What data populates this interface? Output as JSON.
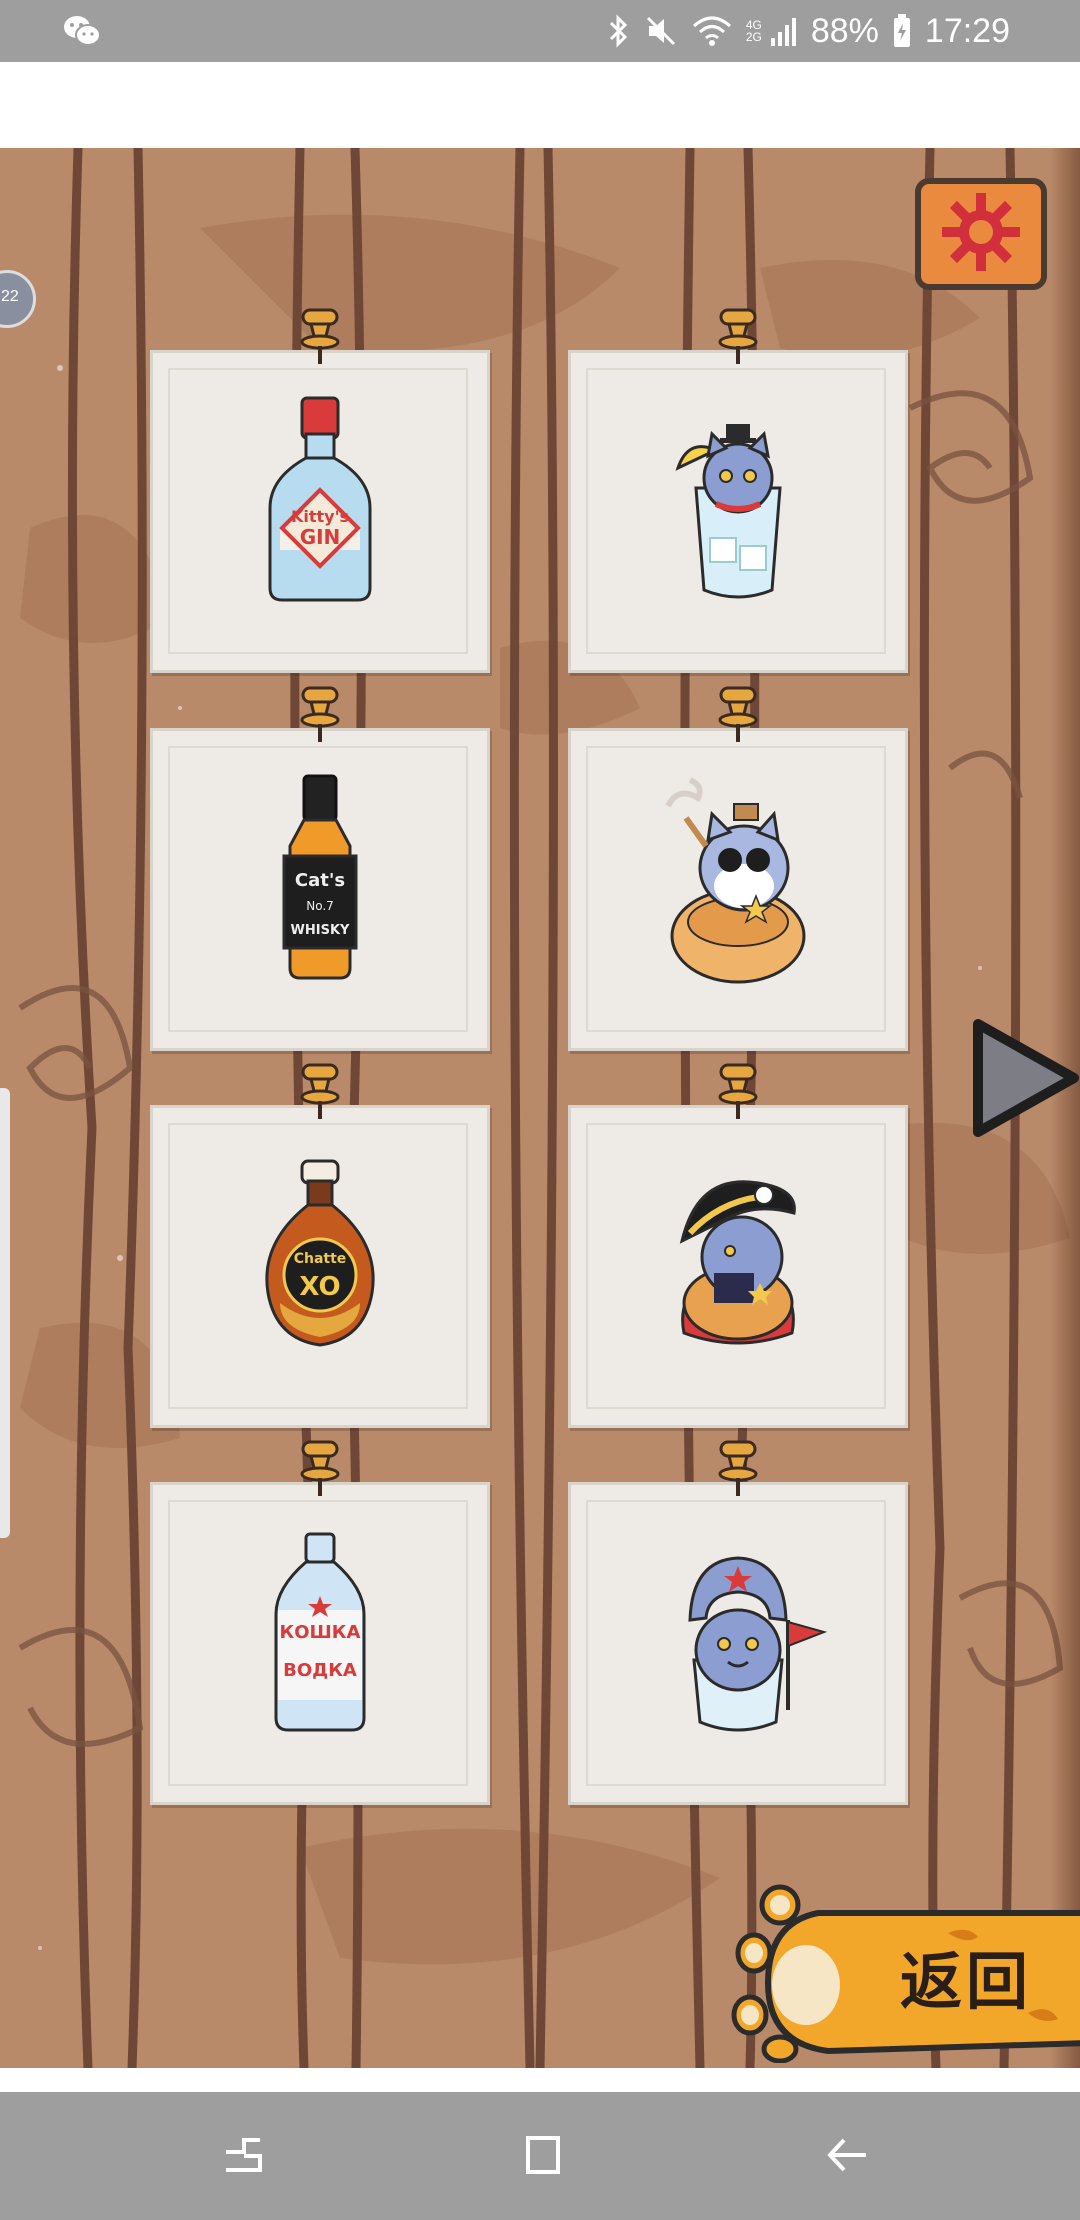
{
  "status_bar": {
    "network": "4G 2G",
    "battery": "88%",
    "time": "17:29",
    "icons": [
      "wechat-icon",
      "bluetooth-icon",
      "mute-icon",
      "wifi-icon",
      "signal-icon",
      "battery-icon"
    ]
  },
  "game": {
    "settings_icon": "gear-icon",
    "next_icon": "play-arrow-icon",
    "side_badge": "22",
    "cards": [
      {
        "name": "gin-bottle",
        "text_lines": [
          "Kitty's",
          "GIN"
        ]
      },
      {
        "name": "cat-in-cocktail-glass",
        "text_lines": []
      },
      {
        "name": "whiskey-bottle",
        "text_lines": [
          "Cat's",
          "No.7",
          "WHISKY"
        ]
      },
      {
        "name": "cat-with-sunglasses",
        "text_lines": []
      },
      {
        "name": "cognac-bottle",
        "text_lines": [
          "Chatte",
          "XO"
        ]
      },
      {
        "name": "cat-in-bicorne-hat",
        "text_lines": []
      },
      {
        "name": "vodka-bottle",
        "text_lines": [
          "КОШКА",
          "ВОДКА"
        ]
      },
      {
        "name": "cat-in-ushanka",
        "text_lines": []
      }
    ],
    "back_button_label": "返回"
  },
  "colors": {
    "wood": "#b98a6a",
    "wood_dark": "#7a5140",
    "paper": "#eeebe6",
    "settings": "#e98a3f",
    "paw": "#f2a72b"
  },
  "nav_bar": {
    "icons": [
      "recent-apps-icon",
      "home-icon",
      "back-icon"
    ]
  }
}
